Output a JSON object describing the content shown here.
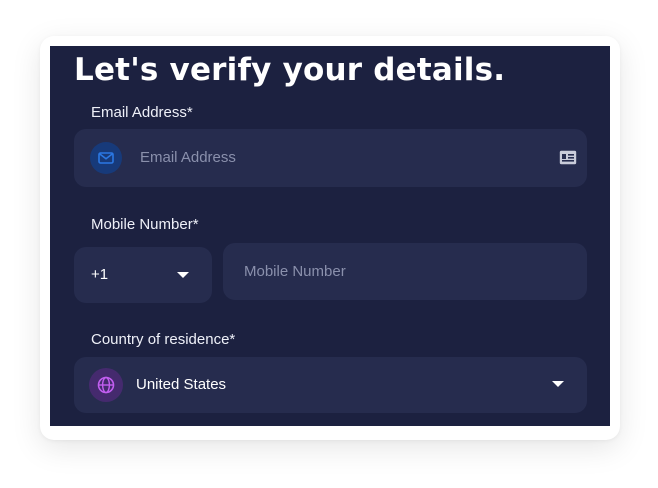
{
  "form": {
    "title": "Let's verify your details.",
    "email": {
      "label": "Email Address*",
      "placeholder": "Email Address",
      "value": ""
    },
    "mobile": {
      "label": "Mobile Number*",
      "country_code": "+1",
      "placeholder": "Mobile Number",
      "value": ""
    },
    "country": {
      "label": "Country of residence*",
      "selected": "United States"
    }
  },
  "colors": {
    "panel_bg": "#1c2140",
    "field_bg": "#262c4e",
    "email_icon": "#2b78e4",
    "globe_icon": "#b04ee0"
  },
  "icons": {
    "email": "envelope-icon",
    "contact_card": "contact-card-icon",
    "country": "globe-icon",
    "dropdown": "caret-down-icon"
  }
}
